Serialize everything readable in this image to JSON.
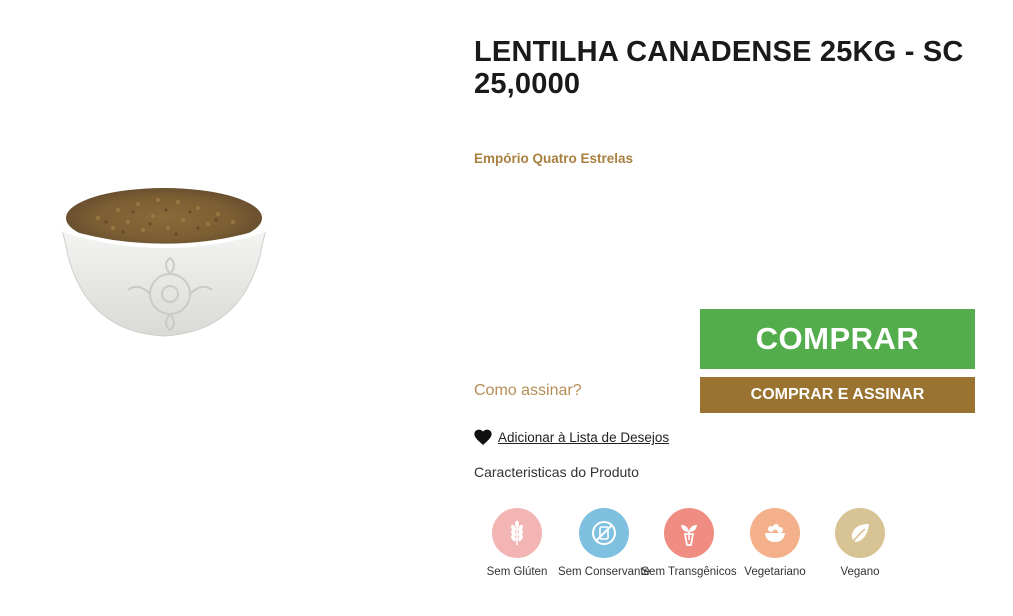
{
  "product": {
    "title": "LENTILHA CANADENSE 25KG - SC 25,0000",
    "brand": "Empório Quatro Estrelas",
    "image_icon": "lentil-bowl-image"
  },
  "actions": {
    "buy_label": "COMPRAR",
    "subscribe_label": "COMPRAR E ASSINAR",
    "how_to_subscribe": "Como assinar?",
    "wishlist_label": "Adicionar à Lista de Desejos"
  },
  "features": {
    "title": "Caracteristicas do Produto",
    "items": [
      {
        "label": "Sem Glúten",
        "icon": "wheat-icon",
        "color": "#f3b4b4"
      },
      {
        "label": "Sem Conservante",
        "icon": "no-preservative-icon",
        "color": "#7fc0e0"
      },
      {
        "label": "Sem Transgênicos",
        "icon": "sprout-icon",
        "color": "#ef8d82"
      },
      {
        "label": "Vegetariano",
        "icon": "salad-bowl-icon",
        "color": "#f4b08a"
      },
      {
        "label": "Vegano",
        "icon": "leaf-icon",
        "color": "#d8c395"
      }
    ]
  },
  "colors": {
    "buy_button": "#53ad4c",
    "subscribe_button": "#9a7331",
    "brand_text": "#a8803f"
  }
}
